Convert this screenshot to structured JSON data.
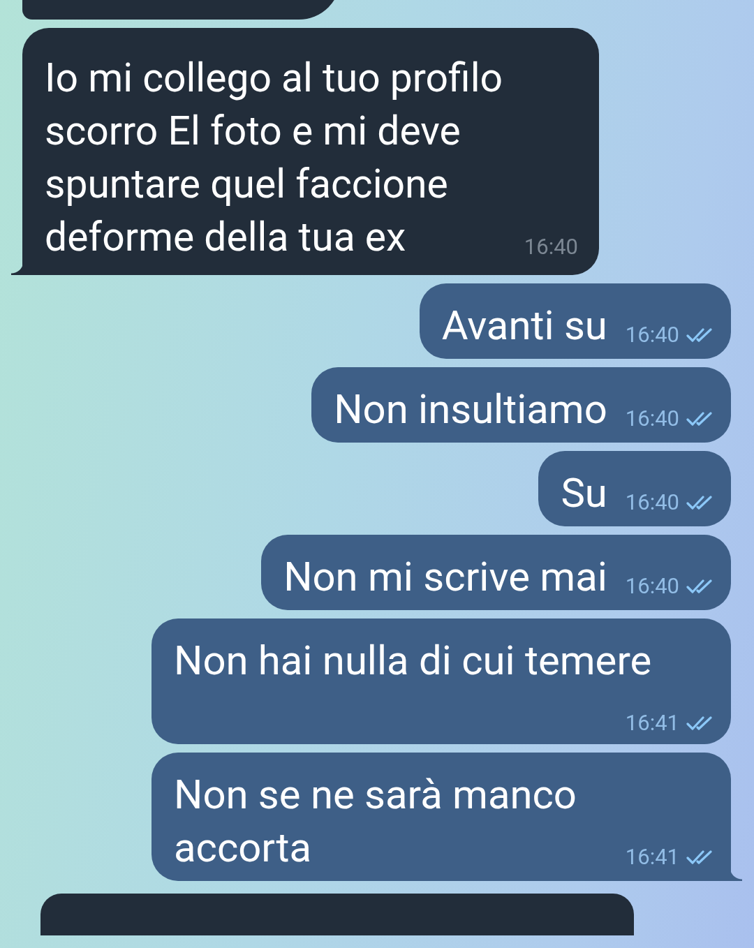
{
  "messages": [
    {
      "kind": "incoming",
      "text": "Io mi collego al tuo profilo scorro El foto e mi deve spuntare quel faccione deforme della tua ex",
      "time": "16:40"
    },
    {
      "kind": "outgoing",
      "text": "Avanti su",
      "time": "16:40",
      "read": true
    },
    {
      "kind": "outgoing",
      "text": "Non insultiamo",
      "time": "16:40",
      "read": true
    },
    {
      "kind": "outgoing",
      "text": "Su",
      "time": "16:40",
      "read": true
    },
    {
      "kind": "outgoing",
      "text": "Non mi scrive mai",
      "time": "16:40",
      "read": true
    },
    {
      "kind": "outgoing",
      "text": "Non hai nulla di cui temere",
      "time": "16:41",
      "read": true
    },
    {
      "kind": "outgoing",
      "text": "Non se ne sarà manco accorta",
      "time": "16:41",
      "read": true
    }
  ]
}
